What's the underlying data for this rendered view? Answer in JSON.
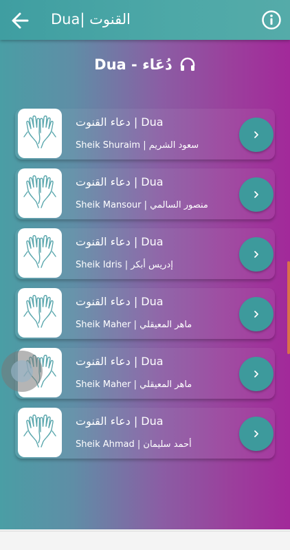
{
  "appbar": {
    "title": "القنوت |Dua",
    "back_icon": "arrow-left-icon",
    "info_icon": "info-icon"
  },
  "heading": {
    "text": "Dua - دُعَاء",
    "icon": "headphones-icon"
  },
  "items": [
    {
      "title": "دعاء القنوت | Dua",
      "subtitle": "Sheik Shuraim | سعود الشريم"
    },
    {
      "title": "دعاء القنوت | Dua",
      "subtitle": "Sheik Mansour | منصور السالمي"
    },
    {
      "title": "دعاء القنوت | Dua",
      "subtitle": "Sheik Idris | إدريس أبكر"
    },
    {
      "title": "دعاء القنوت | Dua",
      "subtitle": "Sheik Maher | ماهر المعيقلي"
    },
    {
      "title": "دعاء القنوت | Dua",
      "subtitle": "Sheik Maher | ماهر المعيقلي"
    },
    {
      "title": "دعاء القنوت | Dua",
      "subtitle": "Sheik Ahmad | أحمد سليمان"
    }
  ],
  "colors": {
    "accent_teal": "#3d9a9c",
    "gradient_left": "#4a9ea5",
    "gradient_right": "#a2299a"
  }
}
